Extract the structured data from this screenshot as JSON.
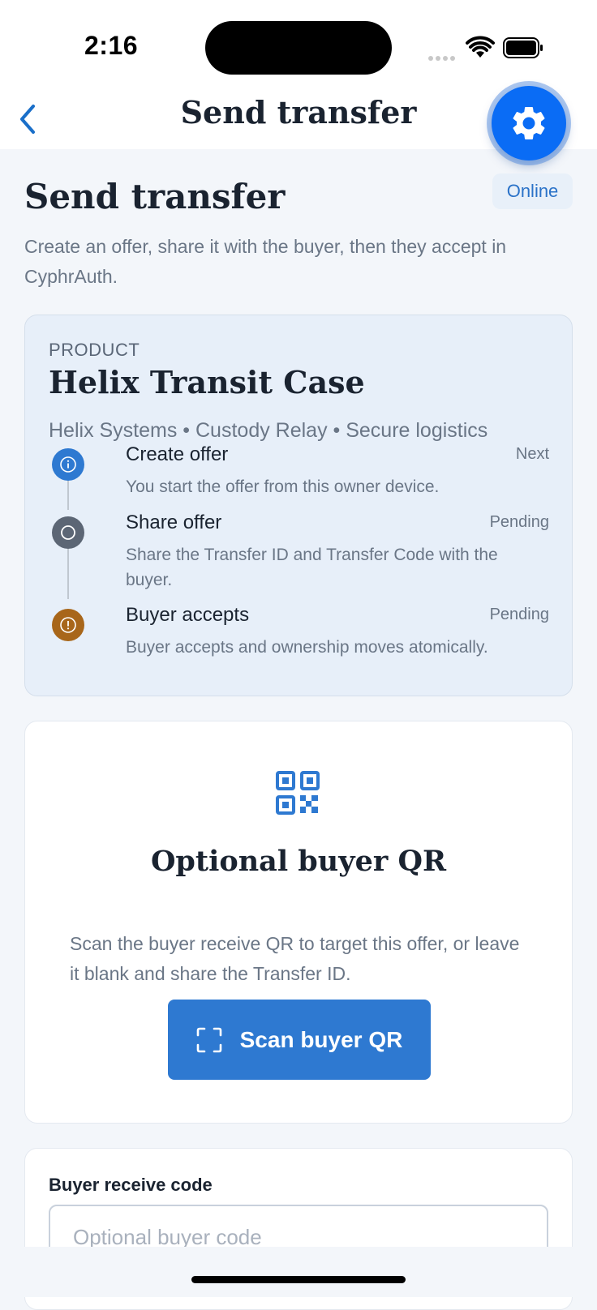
{
  "status_bar": {
    "time": "2:16"
  },
  "nav": {
    "title": "Send transfer",
    "back_icon": "chevron-left-icon",
    "settings_icon": "gear-icon"
  },
  "connection": {
    "status": "Online"
  },
  "header": {
    "title": "Send transfer",
    "subtitle": "Create an offer, share it with the buyer, then they accept in CyphrAuth."
  },
  "product": {
    "eyebrow": "PRODUCT",
    "name": "Helix Transit Case",
    "meta": "Helix Systems • Custody Relay • Secure logistics"
  },
  "steps": [
    {
      "title": "Create offer",
      "status": "Next",
      "description": "You start the offer from this owner device.",
      "icon": "info-icon",
      "color": "#2e79d1"
    },
    {
      "title": "Share offer",
      "status": "Pending",
      "description": "Share the Transfer ID and Transfer Code with the buyer.",
      "icon": "circle-icon",
      "color": "#5c6675"
    },
    {
      "title": "Buyer accepts",
      "status": "Pending",
      "description": "Buyer accepts and ownership moves atomically.",
      "icon": "alert-icon",
      "color": "#a8661a"
    }
  ],
  "qr_section": {
    "title": "Optional buyer QR",
    "description": "Scan the buyer receive QR to target this offer, or leave it blank and share the Transfer ID.",
    "button_label": "Scan buyer QR"
  },
  "buyer_code": {
    "label": "Buyer receive code",
    "placeholder": "Optional buyer code",
    "value": ""
  },
  "colors": {
    "accent": "#2e79d1",
    "fab": "#0a6cf5",
    "card_tint": "#e7eff9"
  }
}
